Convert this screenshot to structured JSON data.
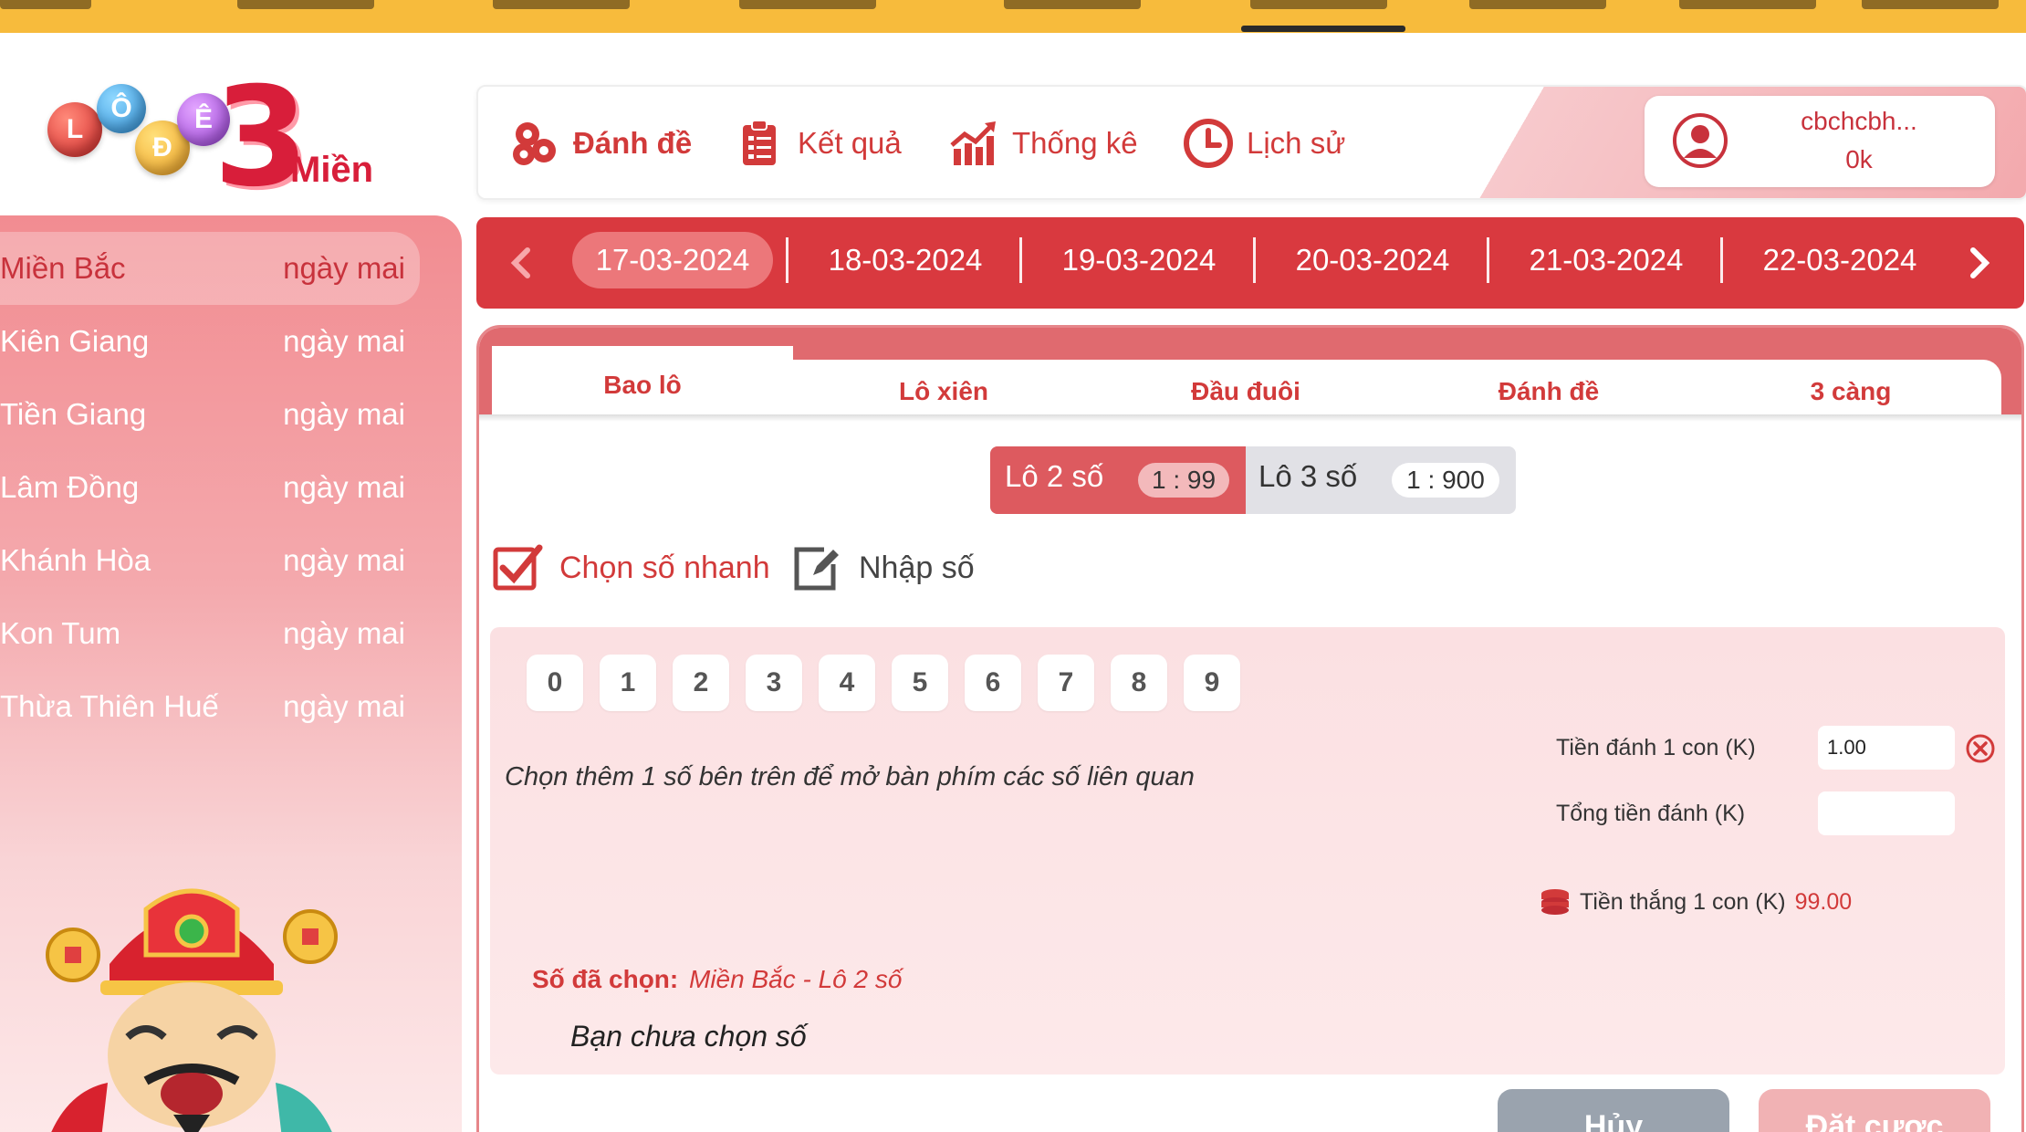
{
  "logo": {
    "letters": [
      "L",
      "Ô",
      "Đ",
      "Ê"
    ],
    "number": "3",
    "word": "Miền"
  },
  "header": {
    "menu": [
      {
        "label": "Đánh đề",
        "icon": "lottery-balls-icon"
      },
      {
        "label": "Kết quả",
        "icon": "clipboard-icon"
      },
      {
        "label": "Thống kê",
        "icon": "chart-icon"
      },
      {
        "label": "Lịch sử",
        "icon": "clock-icon"
      }
    ],
    "user": {
      "name": "cbchcbh...",
      "balance": "0k"
    }
  },
  "sidebar": {
    "regions": [
      {
        "name": "Miền Bắc",
        "when": "ngày mai"
      },
      {
        "name": "Kiên Giang",
        "when": "ngày mai"
      },
      {
        "name": "Tiền Giang",
        "when": "ngày mai"
      },
      {
        "name": "Lâm Đồng",
        "when": "ngày mai"
      },
      {
        "name": "Khánh Hòa",
        "when": "ngày mai"
      },
      {
        "name": "Kon Tum",
        "when": "ngày mai"
      },
      {
        "name": "Thừa Thiên Huế",
        "when": "ngày mai"
      }
    ]
  },
  "dates": [
    "17-03-2024",
    "18-03-2024",
    "19-03-2024",
    "20-03-2024",
    "21-03-2024",
    "22-03-2024"
  ],
  "tabs": [
    "Bao lô",
    "Lô xiên",
    "Đầu đuôi",
    "Đánh đề",
    "3 càng"
  ],
  "segment": {
    "lo2": {
      "label": "Lô 2 số",
      "ratio": "1 : 99"
    },
    "lo3": {
      "label": "Lô 3 số",
      "ratio": "1 : 900"
    }
  },
  "modes": {
    "quick": "Chọn số nhanh",
    "manual": "Nhập số"
  },
  "digits": [
    "0",
    "1",
    "2",
    "3",
    "4",
    "5",
    "6",
    "7",
    "8",
    "9"
  ],
  "hint": "Chọn thêm 1 số bên trên để mở bàn phím các số liên quan",
  "form": {
    "stake_label": "Tiền đánh 1 con (K)",
    "stake_value": "1.00",
    "total_label": "Tổng tiền đánh (K)",
    "total_value": "",
    "win_label": "Tiền thắng 1 con (K)",
    "win_value": "99.00"
  },
  "chosen": {
    "label": "Số đã chọn:",
    "value": "Miền Bắc - Lô 2 số",
    "empty": "Bạn chưa chọn số"
  },
  "buttons": {
    "cancel": "Hủy",
    "bet": "Đặt cược"
  },
  "colors": {
    "primary": "#d9393f",
    "topbar": "#f7bb3c",
    "accent": "#d23a3a"
  }
}
